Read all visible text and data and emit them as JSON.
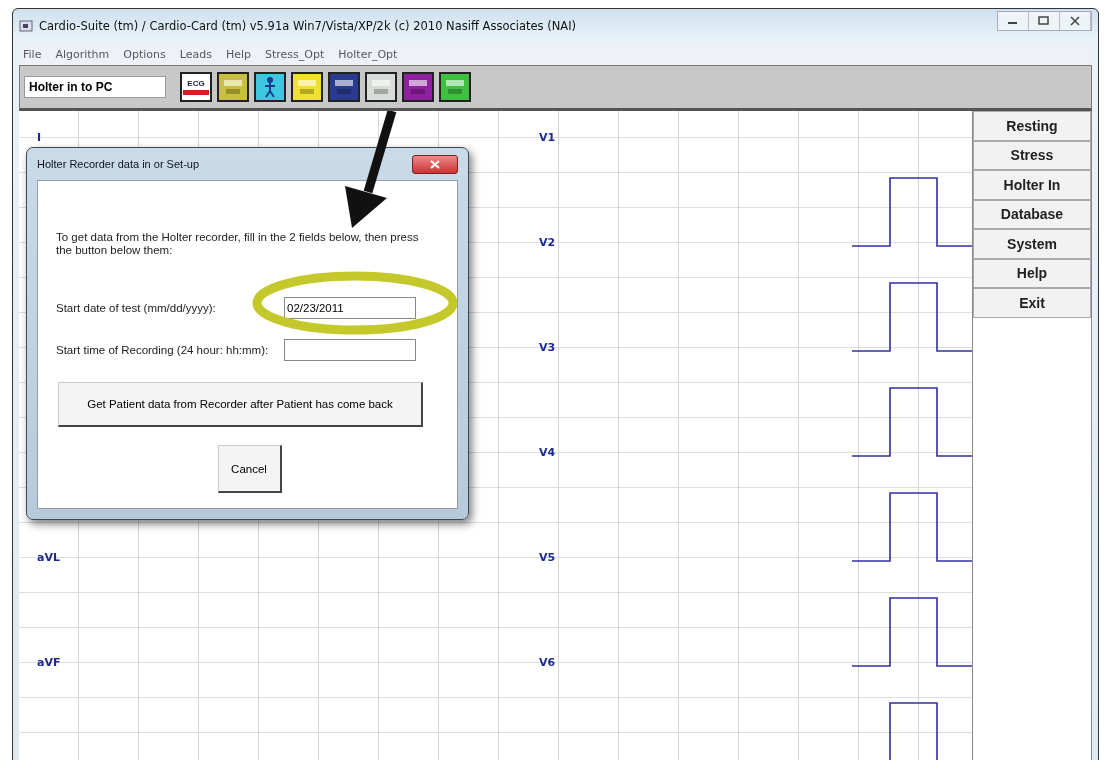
{
  "window": {
    "title": "Cardio-Suite (tm) / Cardio-Card (tm) v5.91a Win7/Vista/XP/2k (c) 2010 Nasiff Associates (NAI)"
  },
  "menu": [
    "File",
    "Algorithm",
    "Options",
    "Leads",
    "Help",
    "Stress_Opt",
    "Holter_Opt"
  ],
  "toolbar": {
    "label": "Holter in to PC",
    "buttons": [
      {
        "kind": "ecg",
        "text": "ECG",
        "color": "#ffffff"
      },
      {
        "kind": "icon",
        "color": "#c8c03a"
      },
      {
        "kind": "figure",
        "color": "#3cc8e0"
      },
      {
        "kind": "icon",
        "color": "#f0e030"
      },
      {
        "kind": "icon",
        "color": "#2a3a90"
      },
      {
        "kind": "icon",
        "color": "#d8dcd8"
      },
      {
        "kind": "icon",
        "color": "#9020a0"
      },
      {
        "kind": "icon",
        "color": "#40c040"
      }
    ]
  },
  "chart": {
    "left_leads": [
      "I",
      "aVL",
      "aVF"
    ],
    "right_leads": [
      "V1",
      "V2",
      "V3",
      "V4",
      "V5",
      "V6"
    ]
  },
  "side_menu": [
    "Resting",
    "Stress",
    "Holter In",
    "Database",
    "System",
    "Help",
    "Exit"
  ],
  "dialog": {
    "title": "Holter Recorder data in or Set-up",
    "instructions": "To get data from the Holter recorder, fill in the 2 fields below, then press the button below them:",
    "fields": [
      {
        "label": "Start date of test (mm/dd/yyyy):",
        "value": "02/23/2011"
      },
      {
        "label": "Start time of Recording (24 hour: hh:mm):"
      }
    ],
    "buttons": [
      "Get Patient data from Recorder after Patient has come back",
      "Cancel"
    ]
  },
  "annotations": {
    "highlight_ellipse": true,
    "pointer_arrow": true
  }
}
